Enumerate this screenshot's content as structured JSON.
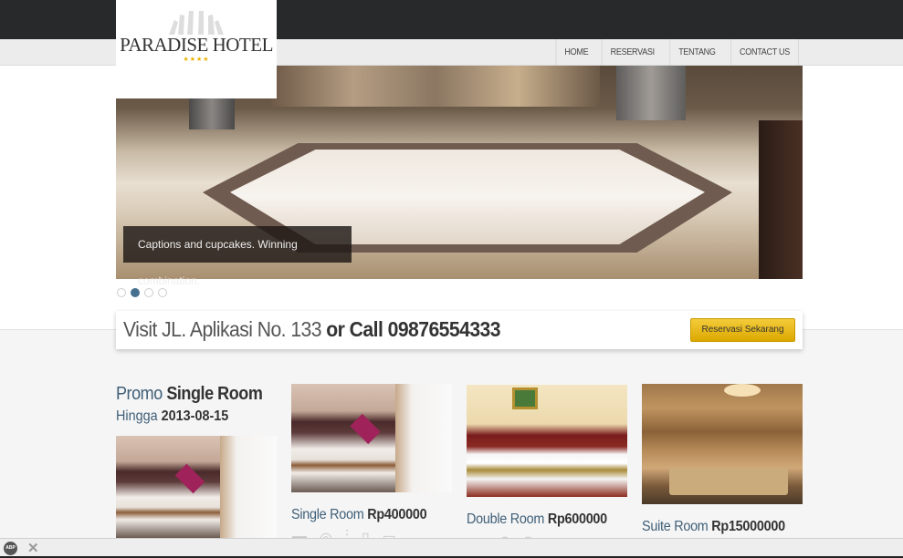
{
  "brand": {
    "name": "PARADISE HOTEL",
    "stars": "★★★★",
    "star_color": "#e6b400"
  },
  "nav": {
    "items": [
      {
        "label": "HOME"
      },
      {
        "label": "RESERVASI"
      },
      {
        "label": "TENTANG"
      },
      {
        "label": "CONTACT US"
      }
    ]
  },
  "slider": {
    "caption": "Captions and cupcakes. Winning combination.",
    "slide_count": 4,
    "active_index": 1
  },
  "cta": {
    "visit_text": "Visit JL. Aplikasi No. 133",
    "call_text": "or Call 09876554333",
    "button_label": "Reservasi Sekarang",
    "button_color": "#e6b400"
  },
  "promo": {
    "prefix": "Promo",
    "room": "Single Room",
    "until_label": "Hingga",
    "until_date": "2013-08-15"
  },
  "rooms": [
    {
      "name": "Single Room",
      "price": "Rp400000"
    },
    {
      "name": "Double Room",
      "price": "Rp600000"
    },
    {
      "name": "Suite Room",
      "price": "Rp15000000"
    }
  ],
  "amenities": {
    "icons": [
      "tv-icon",
      "wifi-icon",
      "heater-icon",
      "thermometer-icon",
      "safe-icon"
    ]
  },
  "bottom_bar": {
    "adblock_label": "ABP",
    "close_label": "✕"
  },
  "colors": {
    "accent_blue": "#3f5f78",
    "topbar": "#28292b",
    "active_dot": "#46708f"
  }
}
